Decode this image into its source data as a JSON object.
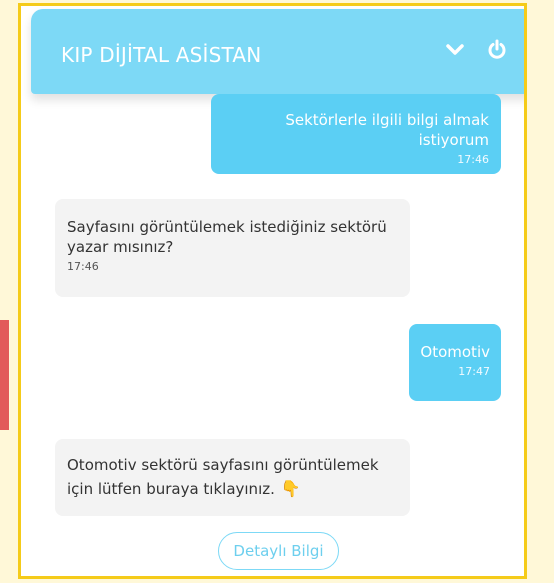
{
  "header": {
    "title": "KIP DİJİTAL ASİSTAN",
    "icons": [
      "chevron-down-icon",
      "power-icon"
    ]
  },
  "messages": [
    {
      "sender": "user",
      "text": "Sektörlerle ilgili bilgi almak istiyorum",
      "time": "17:46"
    },
    {
      "sender": "bot",
      "text": "Sayfasını görüntülemek istediğiniz sektörü yazar mısınız?",
      "time": "17:46"
    },
    {
      "sender": "user",
      "text": "Otomotiv",
      "time": "17:47"
    },
    {
      "sender": "bot",
      "text": "Otomotiv sektörü sayfasını görüntülemek için lütfen buraya tıklayınız."
    }
  ],
  "actions": {
    "detail_button": "Detaylı Bilgi"
  },
  "colors": {
    "header": "#7dd9f6",
    "user_bubble": "#5bcff4",
    "bot_bubble": "#f3f3f3",
    "frame": "#f5cb19",
    "finger_icon": "#f4b11b"
  }
}
